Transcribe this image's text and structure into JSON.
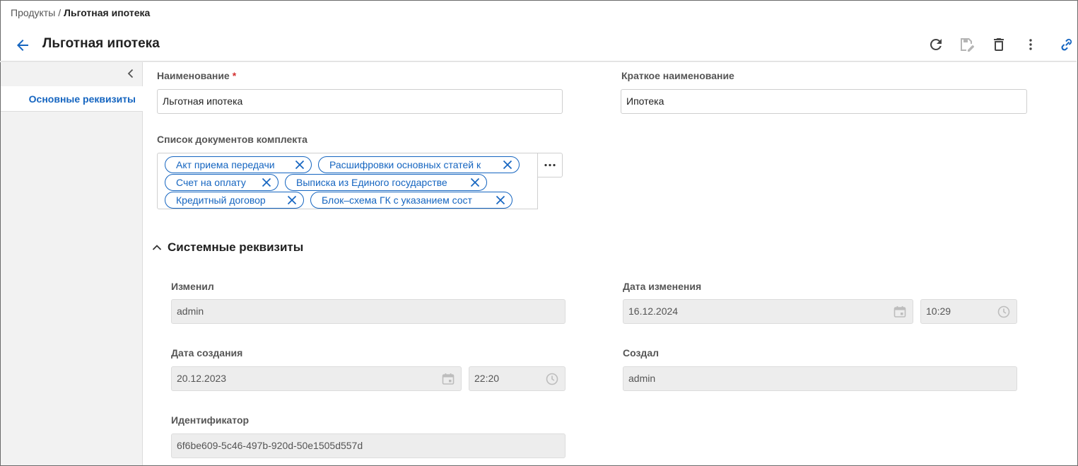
{
  "breadcrumb": {
    "parent": "Продукты",
    "separator": "/",
    "current": "Льготная ипотека"
  },
  "header": {
    "title": "Льготная ипотека"
  },
  "sidebar": {
    "items": [
      {
        "label": "Основные реквизиты",
        "active": true
      }
    ]
  },
  "form": {
    "name": {
      "label": "Наименование",
      "required_mark": "*",
      "value": "Льготная ипотека"
    },
    "short_name": {
      "label": "Краткое наименование",
      "value": "Ипотека"
    },
    "documents": {
      "label": "Список документов комплекта",
      "tags": [
        "Акт приема передачи",
        "Расшифровки основных статей к",
        "Счет на оплату",
        "Выписка из Единого государстве",
        "Кредитный договор",
        "Блок–схема ГК с указанием сост"
      ]
    }
  },
  "system": {
    "title": "Системные реквизиты",
    "changed_by": {
      "label": "Изменил",
      "value": "admin"
    },
    "changed_date": {
      "label": "Дата изменения",
      "date": "16.12.2024",
      "time": "10:29"
    },
    "created_date": {
      "label": "Дата создания",
      "date": "20.12.2023",
      "time": "22:20"
    },
    "created_by": {
      "label": "Создал",
      "value": "admin"
    },
    "identifier": {
      "label": "Идентификатор",
      "value": "6f6be609-5c46-497b-920d-50e1505d557d"
    }
  },
  "colors": {
    "accent": "#1565c0",
    "required": "#d32f2f",
    "readonly_bg": "#ededed",
    "sidebar_bg": "#f2f2f2"
  }
}
